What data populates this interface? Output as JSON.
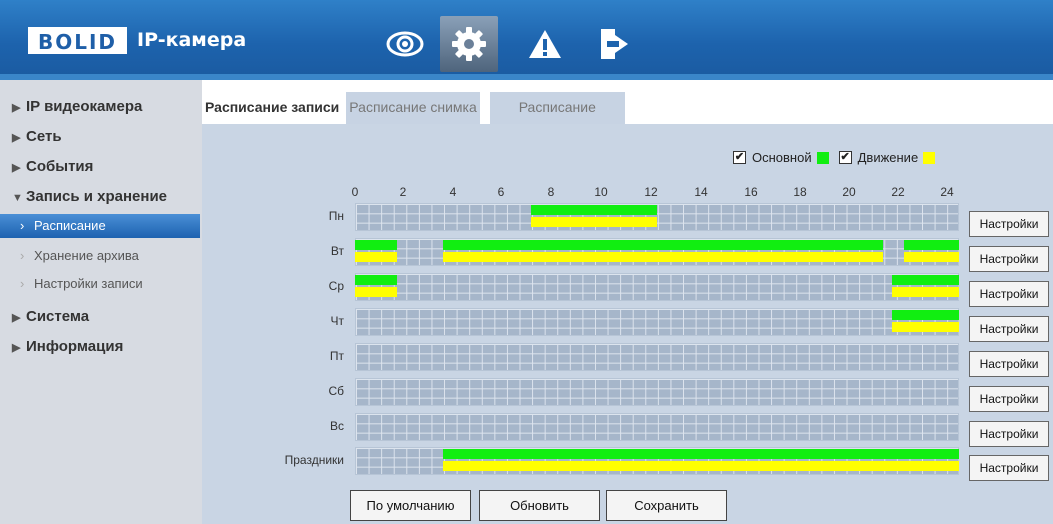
{
  "header": {
    "logo_brand": "BOLID",
    "logo_subtitle": "IP-камера",
    "nav": [
      {
        "icon": "eye-icon"
      },
      {
        "icon": "gear-icon"
      },
      {
        "icon": "warning-icon"
      },
      {
        "icon": "logout-icon"
      }
    ]
  },
  "sidebar": {
    "items": [
      {
        "label": "IP видеокамера",
        "icon": "triangle-right-icon"
      },
      {
        "label": "Сеть",
        "icon": "triangle-right-icon"
      },
      {
        "label": "События",
        "icon": "triangle-right-icon"
      },
      {
        "label": "Запись и хранение",
        "icon": "triangle-down-icon"
      },
      {
        "label": "Система",
        "icon": "triangle-right-icon"
      },
      {
        "label": "Информация",
        "icon": "triangle-right-icon"
      }
    ],
    "subitems": [
      {
        "label": "Расписание",
        "active": true
      },
      {
        "label": "Хранение архива",
        "active": false
      },
      {
        "label": "Настройки записи",
        "active": false
      }
    ]
  },
  "tabs": [
    {
      "label": "Расписание записи",
      "active": true
    },
    {
      "label": "Расписание снимка",
      "active": false
    },
    {
      "label": "Расписание",
      "active": false
    }
  ],
  "legend": {
    "main_label": "Основной",
    "motion_label": "Движение",
    "main_checked": true,
    "motion_checked": true,
    "main_color": "#11ee11",
    "motion_color": "#ffff00"
  },
  "hours": [
    "0",
    "2",
    "4",
    "6",
    "8",
    "10",
    "12",
    "14",
    "16",
    "18",
    "20",
    "22",
    "24"
  ],
  "days": [
    {
      "label": "Пн",
      "main": [
        [
          7,
          12
        ]
      ],
      "motion": [
        [
          7,
          12
        ]
      ]
    },
    {
      "label": "Вт",
      "main": [
        [
          0,
          1.67
        ],
        [
          3.5,
          21
        ],
        [
          21.83,
          24
        ]
      ],
      "motion": [
        [
          0,
          1.67
        ],
        [
          3.5,
          21
        ],
        [
          21.83,
          24
        ]
      ]
    },
    {
      "label": "Ср",
      "main": [
        [
          0,
          1.67
        ],
        [
          21.33,
          24
        ]
      ],
      "motion": [
        [
          0,
          1.67
        ],
        [
          21.33,
          24
        ]
      ]
    },
    {
      "label": "Чт",
      "main": [
        [
          21.33,
          24
        ]
      ],
      "motion": [
        [
          21.33,
          24
        ]
      ]
    },
    {
      "label": "Пт",
      "main": [],
      "motion": []
    },
    {
      "label": "Сб",
      "main": [],
      "motion": []
    },
    {
      "label": "Вс",
      "main": [],
      "motion": []
    },
    {
      "label": "Праздники",
      "main": [
        [
          3.5,
          24
        ]
      ],
      "motion": [
        [
          3.5,
          24
        ]
      ]
    }
  ],
  "settings_button_label": "Настройки",
  "buttons": {
    "default": "По умолчанию",
    "refresh": "Обновить",
    "save": "Сохранить"
  }
}
